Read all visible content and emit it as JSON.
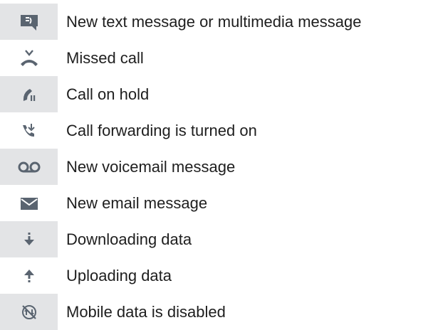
{
  "legend": {
    "items": [
      {
        "icon": "text-message-icon",
        "label": "New text message or multimedia message"
      },
      {
        "icon": "missed-call-icon",
        "label": "Missed call"
      },
      {
        "icon": "call-on-hold-icon",
        "label": "Call on hold"
      },
      {
        "icon": "call-forwarding-icon",
        "label": "Call forwarding is turned on"
      },
      {
        "icon": "voicemail-icon",
        "label": "New voicemail message"
      },
      {
        "icon": "email-icon",
        "label": "New email message"
      },
      {
        "icon": "download-icon",
        "label": "Downloading data"
      },
      {
        "icon": "upload-icon",
        "label": "Uploading data"
      },
      {
        "icon": "mobile-data-disabled-icon",
        "label": "Mobile data is disabled"
      }
    ]
  },
  "colors": {
    "icon": "#5a6470",
    "shade": "#e3e4e6",
    "text": "#1e1e1e"
  }
}
